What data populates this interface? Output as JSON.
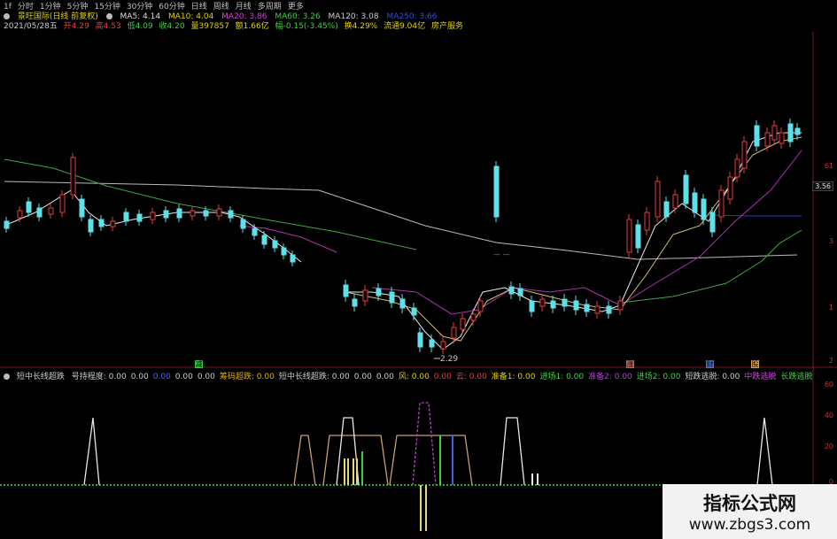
{
  "toolbar": {
    "tabs": [
      "1f",
      "分时",
      "1分钟",
      "5分钟",
      "15分钟",
      "30分钟",
      "60分钟",
      "日线",
      "周线",
      "月线",
      "多周期",
      "更多"
    ]
  },
  "main_header": {
    "stock": "景旺国际(日线 前复权)",
    "ma5": "MA5: 4.14",
    "ma10": "MA10: 4.04",
    "ma20": "MA20: 3.86",
    "ma60": "MA60: 3.26",
    "ma120": "MA120: 3.08",
    "ma250": "MA250: 3.66"
  },
  "info": {
    "date": "2021/05/28五",
    "open": "开4.29",
    "high": "高4.53",
    "low": "低4.09",
    "close": "收4.20",
    "volume": "量397857",
    "amount": "额1.66亿",
    "change": "幅-0.15(-3.45%)",
    "turnover": "换4.29%",
    "float_cap": "流通9.04亿",
    "industry": "房产服务"
  },
  "price_axis": {
    "label_61": "61",
    "current": "3.56",
    "label_3": "3",
    "label_1": "1",
    "label_2": "2"
  },
  "low_marker": "2.29",
  "event_marks": [
    {
      "text": "减",
      "color": "#2ecc40"
    },
    {
      "text": "涨",
      "color": "#d45a5a"
    },
    {
      "text": "财",
      "color": "#4b6fd6"
    },
    {
      "text": "股",
      "color": "#d4a05a"
    }
  ],
  "indicator": {
    "name": "短中长线超跌",
    "items": [
      {
        "label": "号持程度: 0.00",
        "color": "#ccc"
      },
      {
        "label": "0.00",
        "color": "#ccc"
      },
      {
        "label": "0.00",
        "color": "#5b5bff"
      },
      {
        "label": "0.00",
        "color": "#ccc"
      },
      {
        "label": "0.00",
        "color": "#ccc"
      },
      {
        "label": "筹码超跌: 0.00",
        "color": "#e0b400"
      },
      {
        "label": "短中长线超跌: 0.00",
        "color": "#ccc"
      },
      {
        "label": "0.00",
        "color": "#ccc"
      },
      {
        "label": "0.00",
        "color": "#ccc"
      },
      {
        "label": "风: 0.00",
        "color": "#e0d000"
      },
      {
        "label": "0.00",
        "color": "#e04040"
      },
      {
        "label": "云: 0.00",
        "color": "#e04040"
      },
      {
        "label": "准备1: 0.00",
        "color": "#e0d000"
      },
      {
        "label": "进场1: 0.00",
        "color": "#3fcf3f"
      },
      {
        "label": "准备2: 0.00",
        "color": "#b040d0"
      },
      {
        "label": "进场2: 0.00",
        "color": "#3fcf3f"
      },
      {
        "label": "短跌逃脱: 0.00",
        "color": "#ccc"
      },
      {
        "label": "中跌逃脱",
        "color": "#c050d0"
      },
      {
        "label": "长跌逃脱",
        "color": "#3fcf3f"
      }
    ],
    "axis": [
      "60",
      "40",
      "20",
      "0"
    ]
  },
  "watermark": {
    "title": "指标公式网",
    "url": "www.zbgs3.com"
  }
}
